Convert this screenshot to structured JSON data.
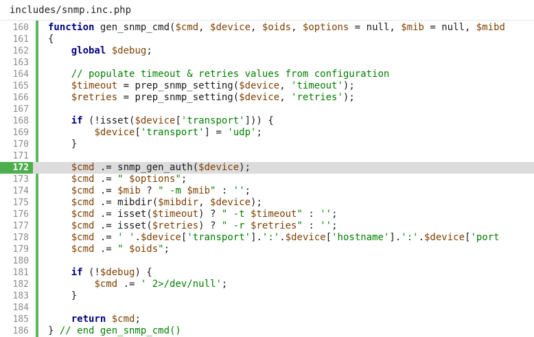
{
  "file": {
    "name": "includes/snmp.inc.php"
  },
  "editor": {
    "active_line": 172,
    "lines": [
      {
        "num": "160",
        "tokens": [
          {
            "t": "kw",
            "v": "function"
          },
          {
            "t": "plain",
            "v": " gen_snmp_cmd("
          },
          {
            "t": "var",
            "v": "$cmd"
          },
          {
            "t": "plain",
            "v": ", "
          },
          {
            "t": "var",
            "v": "$device"
          },
          {
            "t": "plain",
            "v": ", "
          },
          {
            "t": "var",
            "v": "$oids"
          },
          {
            "t": "plain",
            "v": ", "
          },
          {
            "t": "var",
            "v": "$options"
          },
          {
            "t": "plain",
            "v": " = null, "
          },
          {
            "t": "var",
            "v": "$mib"
          },
          {
            "t": "plain",
            "v": " = null, "
          },
          {
            "t": "var",
            "v": "$mibd"
          }
        ]
      },
      {
        "num": "161",
        "tokens": [
          {
            "t": "plain",
            "v": "{"
          }
        ]
      },
      {
        "num": "162",
        "tokens": [
          {
            "t": "plain",
            "v": "    "
          },
          {
            "t": "kw",
            "v": "global"
          },
          {
            "t": "plain",
            "v": " "
          },
          {
            "t": "var",
            "v": "$debug"
          },
          {
            "t": "plain",
            "v": ";"
          }
        ]
      },
      {
        "num": "163",
        "tokens": []
      },
      {
        "num": "164",
        "tokens": [
          {
            "t": "plain",
            "v": "    "
          },
          {
            "t": "com",
            "v": "// populate timeout & retries values from configuration"
          }
        ]
      },
      {
        "num": "165",
        "tokens": [
          {
            "t": "plain",
            "v": "    "
          },
          {
            "t": "var",
            "v": "$timeout"
          },
          {
            "t": "plain",
            "v": " = prep_snmp_setting("
          },
          {
            "t": "var",
            "v": "$device"
          },
          {
            "t": "plain",
            "v": ", "
          },
          {
            "t": "str",
            "v": "'timeout'"
          },
          {
            "t": "plain",
            "v": ");"
          }
        ]
      },
      {
        "num": "166",
        "tokens": [
          {
            "t": "plain",
            "v": "    "
          },
          {
            "t": "var",
            "v": "$retries"
          },
          {
            "t": "plain",
            "v": " = prep_snmp_setting("
          },
          {
            "t": "var",
            "v": "$device"
          },
          {
            "t": "plain",
            "v": ", "
          },
          {
            "t": "str",
            "v": "'retries'"
          },
          {
            "t": "plain",
            "v": ");"
          }
        ]
      },
      {
        "num": "167",
        "tokens": []
      },
      {
        "num": "168",
        "tokens": [
          {
            "t": "plain",
            "v": "    "
          },
          {
            "t": "kw",
            "v": "if"
          },
          {
            "t": "plain",
            "v": " (!isset("
          },
          {
            "t": "var",
            "v": "$device"
          },
          {
            "t": "plain",
            "v": "["
          },
          {
            "t": "str",
            "v": "'transport'"
          },
          {
            "t": "plain",
            "v": "])) {"
          }
        ]
      },
      {
        "num": "169",
        "tokens": [
          {
            "t": "plain",
            "v": "        "
          },
          {
            "t": "var",
            "v": "$device"
          },
          {
            "t": "plain",
            "v": "["
          },
          {
            "t": "str",
            "v": "'transport'"
          },
          {
            "t": "plain",
            "v": "] = "
          },
          {
            "t": "str",
            "v": "'udp'"
          },
          {
            "t": "plain",
            "v": ";"
          }
        ]
      },
      {
        "num": "170",
        "tokens": [
          {
            "t": "plain",
            "v": "    }"
          }
        ]
      },
      {
        "num": "171",
        "tokens": []
      },
      {
        "num": "172",
        "tokens": [
          {
            "t": "plain",
            "v": "    "
          },
          {
            "t": "var",
            "v": "$cmd"
          },
          {
            "t": "plain",
            "v": " .= snmp_gen_auth("
          },
          {
            "t": "var",
            "v": "$device"
          },
          {
            "t": "plain",
            "v": ");"
          }
        ]
      },
      {
        "num": "173",
        "tokens": [
          {
            "t": "plain",
            "v": "    "
          },
          {
            "t": "var",
            "v": "$cmd"
          },
          {
            "t": "plain",
            "v": " .= "
          },
          {
            "t": "str",
            "v": "\" "
          },
          {
            "t": "var",
            "v": "$options"
          },
          {
            "t": "str",
            "v": "\""
          },
          {
            "t": "plain",
            "v": ";"
          }
        ]
      },
      {
        "num": "174",
        "tokens": [
          {
            "t": "plain",
            "v": "    "
          },
          {
            "t": "var",
            "v": "$cmd"
          },
          {
            "t": "plain",
            "v": " .= "
          },
          {
            "t": "var",
            "v": "$mib"
          },
          {
            "t": "plain",
            "v": " ? "
          },
          {
            "t": "str",
            "v": "\" -m "
          },
          {
            "t": "var",
            "v": "$mib"
          },
          {
            "t": "str",
            "v": "\""
          },
          {
            "t": "plain",
            "v": " : "
          },
          {
            "t": "str",
            "v": "''"
          },
          {
            "t": "plain",
            "v": ";"
          }
        ]
      },
      {
        "num": "175",
        "tokens": [
          {
            "t": "plain",
            "v": "    "
          },
          {
            "t": "var",
            "v": "$cmd"
          },
          {
            "t": "plain",
            "v": " .= mibdir("
          },
          {
            "t": "var",
            "v": "$mibdir"
          },
          {
            "t": "plain",
            "v": ", "
          },
          {
            "t": "var",
            "v": "$device"
          },
          {
            "t": "plain",
            "v": ");"
          }
        ]
      },
      {
        "num": "176",
        "tokens": [
          {
            "t": "plain",
            "v": "    "
          },
          {
            "t": "var",
            "v": "$cmd"
          },
          {
            "t": "plain",
            "v": " .= isset("
          },
          {
            "t": "var",
            "v": "$timeout"
          },
          {
            "t": "plain",
            "v": ") ? "
          },
          {
            "t": "str",
            "v": "\" -t "
          },
          {
            "t": "var",
            "v": "$timeout"
          },
          {
            "t": "str",
            "v": "\""
          },
          {
            "t": "plain",
            "v": " : "
          },
          {
            "t": "str",
            "v": "''"
          },
          {
            "t": "plain",
            "v": ";"
          }
        ]
      },
      {
        "num": "177",
        "tokens": [
          {
            "t": "plain",
            "v": "    "
          },
          {
            "t": "var",
            "v": "$cmd"
          },
          {
            "t": "plain",
            "v": " .= isset("
          },
          {
            "t": "var",
            "v": "$retries"
          },
          {
            "t": "plain",
            "v": ") ? "
          },
          {
            "t": "str",
            "v": "\" -r "
          },
          {
            "t": "var",
            "v": "$retries"
          },
          {
            "t": "str",
            "v": "\""
          },
          {
            "t": "plain",
            "v": " : "
          },
          {
            "t": "str",
            "v": "''"
          },
          {
            "t": "plain",
            "v": ";"
          }
        ]
      },
      {
        "num": "178",
        "tokens": [
          {
            "t": "plain",
            "v": "    "
          },
          {
            "t": "var",
            "v": "$cmd"
          },
          {
            "t": "plain",
            "v": " .= "
          },
          {
            "t": "str",
            "v": "' '"
          },
          {
            "t": "plain",
            "v": "."
          },
          {
            "t": "var",
            "v": "$device"
          },
          {
            "t": "plain",
            "v": "["
          },
          {
            "t": "str",
            "v": "'transport'"
          },
          {
            "t": "plain",
            "v": "]."
          },
          {
            "t": "str",
            "v": "':'"
          },
          {
            "t": "plain",
            "v": "."
          },
          {
            "t": "var",
            "v": "$device"
          },
          {
            "t": "plain",
            "v": "["
          },
          {
            "t": "str",
            "v": "'hostname'"
          },
          {
            "t": "plain",
            "v": "]."
          },
          {
            "t": "str",
            "v": "':'"
          },
          {
            "t": "plain",
            "v": "."
          },
          {
            "t": "var",
            "v": "$device"
          },
          {
            "t": "plain",
            "v": "["
          },
          {
            "t": "str",
            "v": "'port"
          }
        ]
      },
      {
        "num": "179",
        "tokens": [
          {
            "t": "plain",
            "v": "    "
          },
          {
            "t": "var",
            "v": "$cmd"
          },
          {
            "t": "plain",
            "v": " .= "
          },
          {
            "t": "str",
            "v": "\" "
          },
          {
            "t": "var",
            "v": "$oids"
          },
          {
            "t": "str",
            "v": "\""
          },
          {
            "t": "plain",
            "v": ";"
          }
        ]
      },
      {
        "num": "180",
        "tokens": []
      },
      {
        "num": "181",
        "tokens": [
          {
            "t": "plain",
            "v": "    "
          },
          {
            "t": "kw",
            "v": "if"
          },
          {
            "t": "plain",
            "v": " (!"
          },
          {
            "t": "var",
            "v": "$debug"
          },
          {
            "t": "plain",
            "v": ") {"
          }
        ]
      },
      {
        "num": "182",
        "tokens": [
          {
            "t": "plain",
            "v": "        "
          },
          {
            "t": "var",
            "v": "$cmd"
          },
          {
            "t": "plain",
            "v": " .= "
          },
          {
            "t": "str",
            "v": "' 2>/dev/null'"
          },
          {
            "t": "plain",
            "v": ";"
          }
        ]
      },
      {
        "num": "183",
        "tokens": [
          {
            "t": "plain",
            "v": "    }"
          }
        ]
      },
      {
        "num": "184",
        "tokens": []
      },
      {
        "num": "185",
        "tokens": [
          {
            "t": "plain",
            "v": "    "
          },
          {
            "t": "kw",
            "v": "return"
          },
          {
            "t": "plain",
            "v": " "
          },
          {
            "t": "var",
            "v": "$cmd"
          },
          {
            "t": "plain",
            "v": ";"
          }
        ]
      },
      {
        "num": "186",
        "tokens": [
          {
            "t": "plain",
            "v": "} "
          },
          {
            "t": "com",
            "v": "// end gen_snmp_cmd()"
          }
        ]
      }
    ]
  },
  "colors": {
    "keyword": "#00007f",
    "variable": "#7f3f00",
    "string": "#007f00",
    "comment": "#007f00",
    "gutter_accent": "#5cb85c",
    "active_line_bg": "#dcdcdc"
  }
}
